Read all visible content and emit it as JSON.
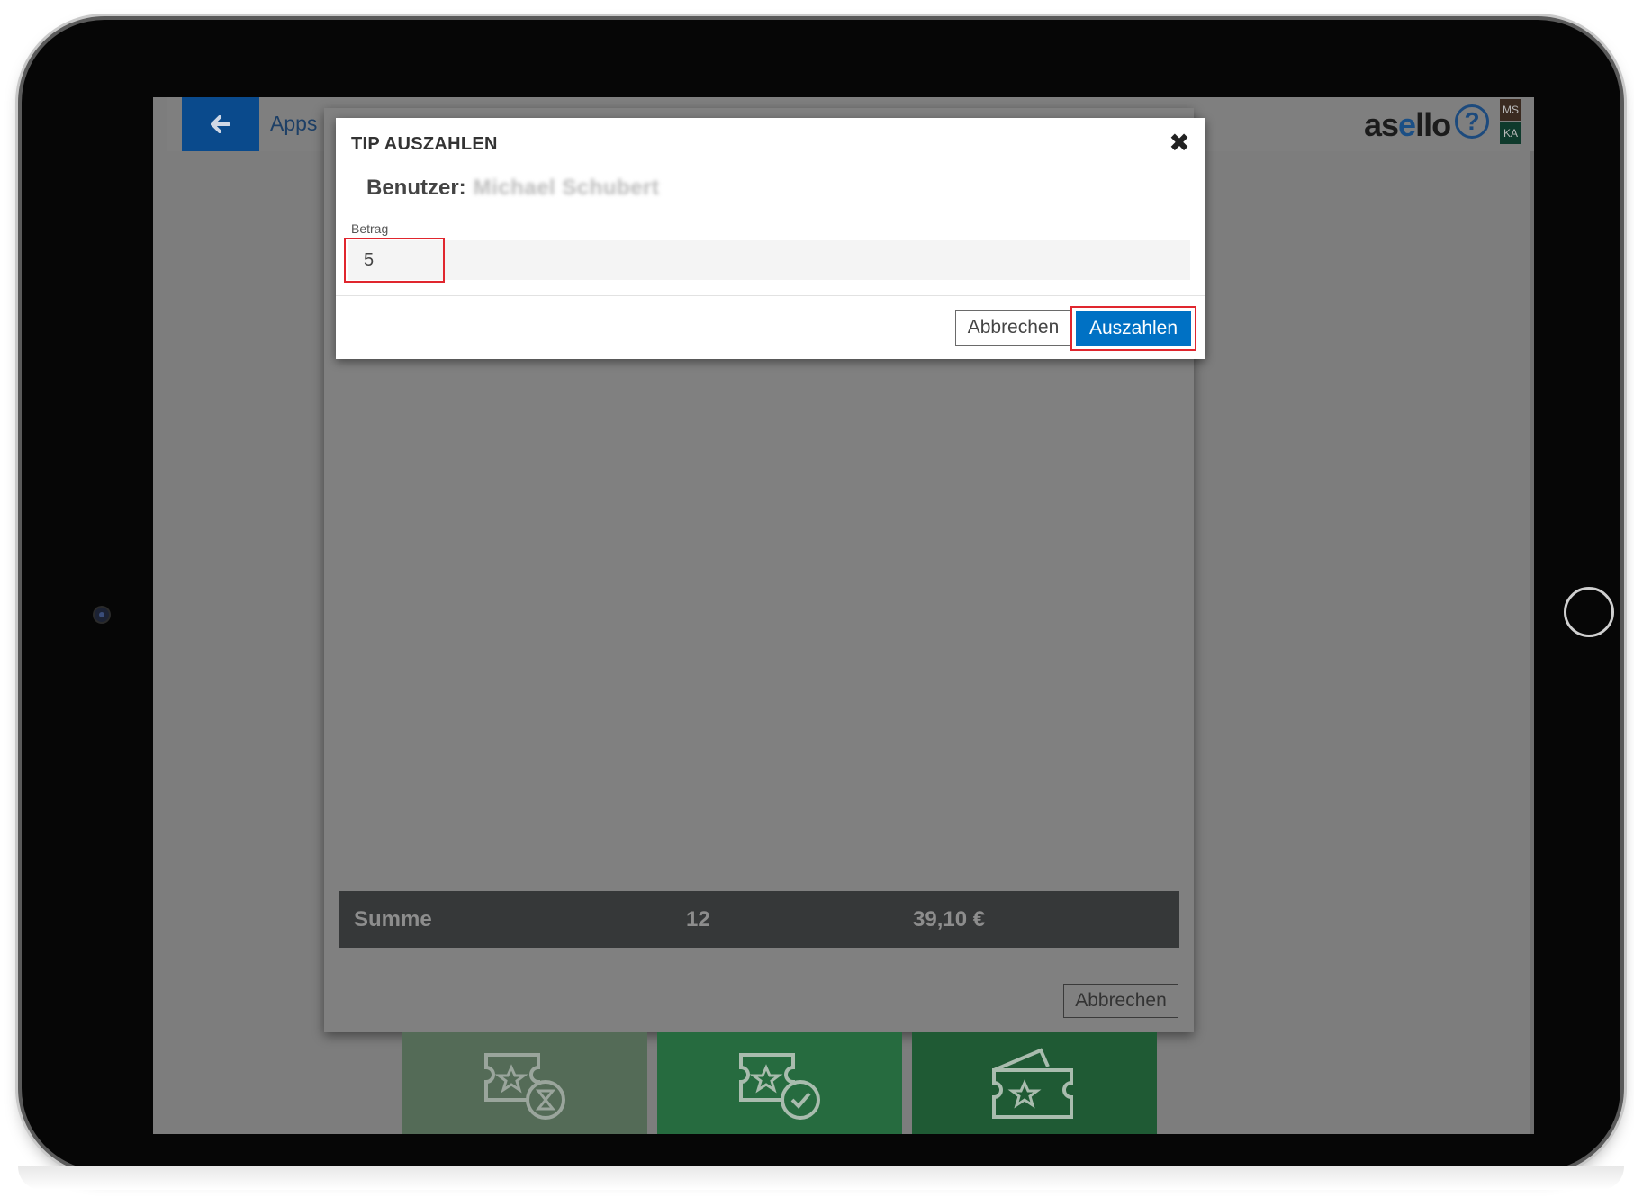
{
  "topbar": {
    "apps_label": "Apps",
    "logo_prefix": "as",
    "logo_accent": "e",
    "logo_suffix": "llo",
    "help_symbol": "?",
    "avatar_top": "MS",
    "avatar_bottom": "KA",
    "back_icon": "arrow-left-icon"
  },
  "modal": {
    "title": "TIP AUSZAHLEN",
    "close_symbol": "✖",
    "user_label": "Benutzer:",
    "user_name": "Michael Schubert",
    "amount_label": "Betrag",
    "amount_value": "5",
    "cancel_label": "Abbrechen",
    "pay_label": "Auszahlen"
  },
  "background_dialog": {
    "sum_label": "Summe",
    "sum_count": "12",
    "sum_total": "39,10 €",
    "cancel_label": "Abbrechen"
  },
  "tiles": [
    {
      "icon": "ticket-pending-icon"
    },
    {
      "icon": "ticket-check-icon"
    },
    {
      "icon": "ticket-open-icon"
    }
  ],
  "colors": {
    "primary_blue": "#0071c4",
    "highlight_red": "#e0262e",
    "tile_green": "#266b3f"
  }
}
